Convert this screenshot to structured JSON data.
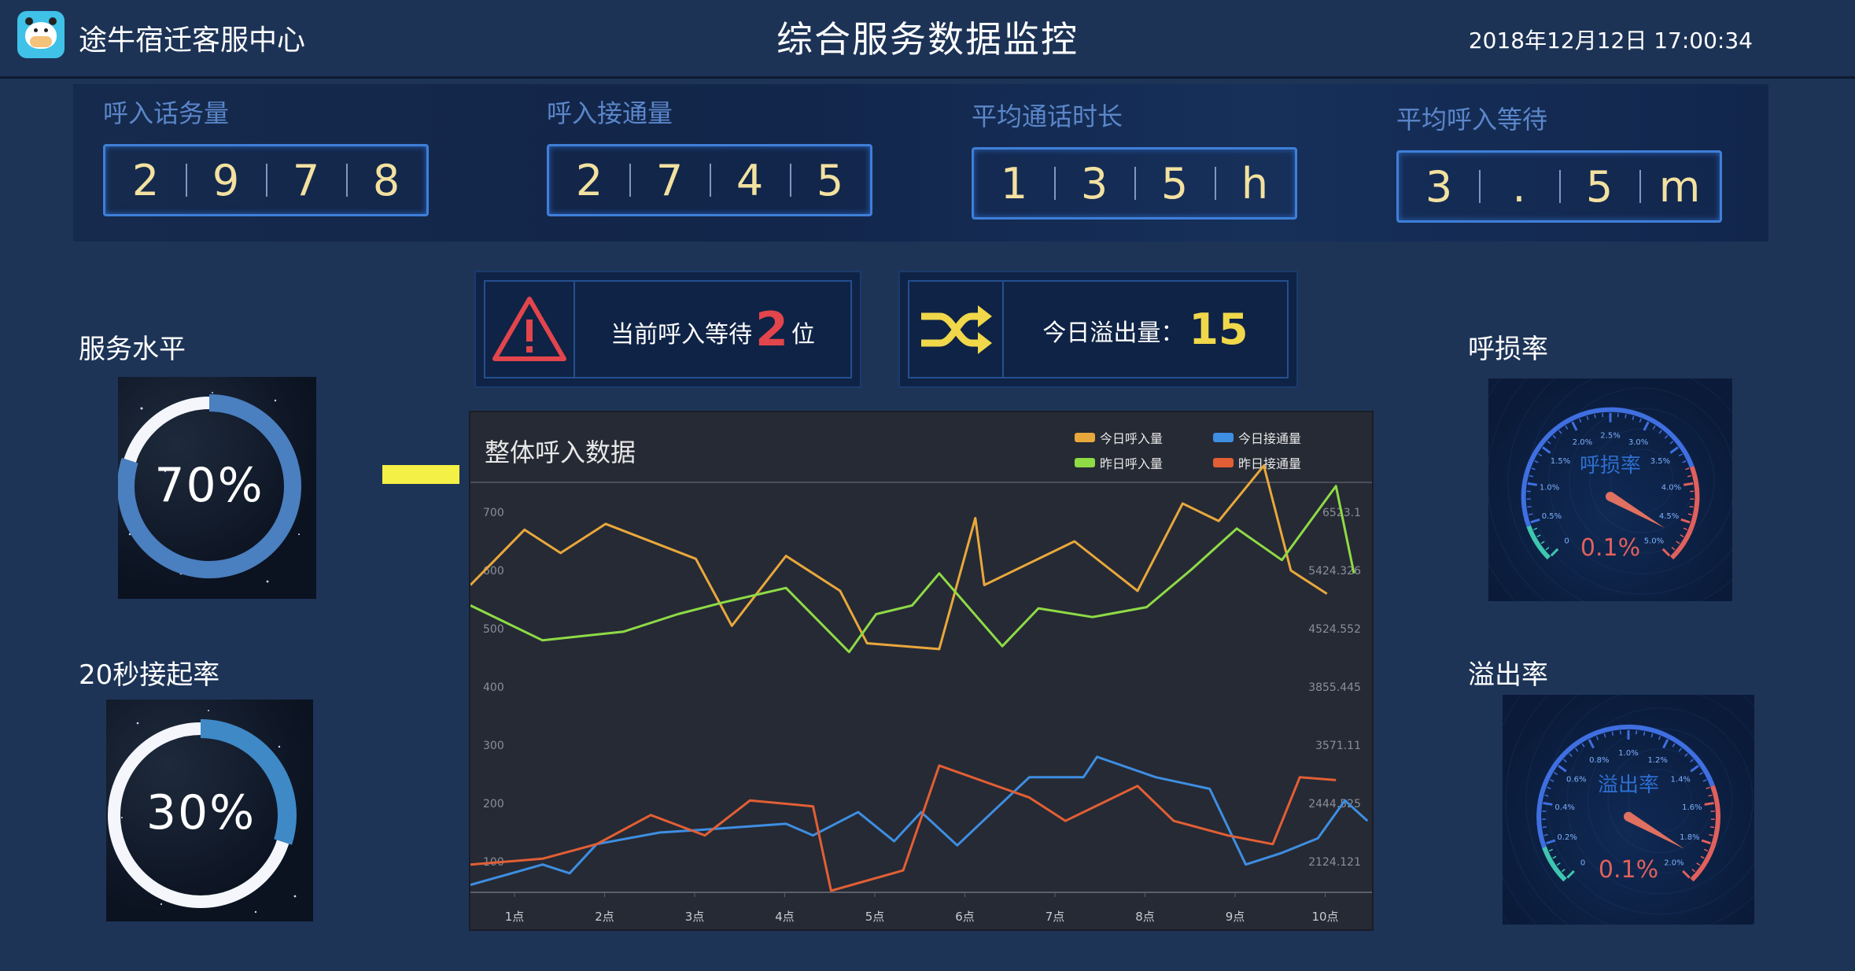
{
  "header": {
    "app_title": "途牛宿迁客服中心",
    "page_title": "综合服务数据监控",
    "datetime": "2018年12月12日 17:00:34"
  },
  "kpis": [
    {
      "label": "呼入话务量",
      "digits": [
        "2",
        "9",
        "7",
        "8"
      ]
    },
    {
      "label": "呼入接通量",
      "digits": [
        "2",
        "7",
        "4",
        "5"
      ]
    },
    {
      "label": "平均通话时长",
      "digits": [
        "1",
        "3",
        "5",
        "h"
      ]
    },
    {
      "label": "平均呼入等待",
      "digits": [
        "3",
        ".",
        "5",
        "m"
      ]
    }
  ],
  "alerts": {
    "waiting_prefix": "当前呼入等待",
    "waiting_count": "2",
    "waiting_suffix": "位",
    "overflow_label": "今日溢出量：",
    "overflow_count": "15"
  },
  "left_panels": {
    "service_level": {
      "label": "服务水平",
      "value_text": "70%",
      "value": 0.7
    },
    "answer_20s": {
      "label": "20秒接起率",
      "value_text": "30%",
      "value": 0.3
    }
  },
  "right_panels": {
    "loss_rate": {
      "label": "呼损率",
      "gauge_title": "呼损率",
      "value_text": "0.1%",
      "value": 0.1,
      "ticks": [
        "0",
        "0.5%",
        "1.0%",
        "1.5%",
        "2.0%",
        "2.5%",
        "3.0%",
        "3.5%",
        "4.0%",
        "4.5%",
        "5.0%"
      ]
    },
    "overflow_rate": {
      "label": "溢出率",
      "gauge_title": "溢出率",
      "value_text": "0.1%",
      "value": 0.1,
      "ticks": [
        "0",
        "0.2%",
        "0.4%",
        "0.6%",
        "0.8%",
        "1.0%",
        "1.2%",
        "1.4%",
        "1.6%",
        "1.8%",
        "2.0%"
      ]
    }
  },
  "colors": {
    "today_calls": "#e9a83c",
    "today_connected": "#3e8ee2",
    "yesterday_calls": "#8edb46",
    "yesterday_connected": "#e25f35"
  },
  "chart_data": {
    "type": "line",
    "title": "整体呼入数据",
    "x_labels": [
      "1点",
      "2点",
      "3点",
      "4点",
      "5点",
      "6点",
      "7点",
      "8点",
      "9点",
      "10点"
    ],
    "y_left_ticks": [
      "100",
      "200",
      "300",
      "400",
      "500",
      "600",
      "700"
    ],
    "y_right_ticks": [
      "2124.121",
      "2444.525",
      "3571.11",
      "3855.445",
      "4524.552",
      "5424.326",
      "6523.1"
    ],
    "ylim": [
      50,
      750
    ],
    "x": [
      0,
      0.2,
      0.4,
      0.6,
      0.8,
      1,
      1.2,
      1.4,
      1.6,
      1.8,
      2,
      2.2,
      2.4,
      2.6,
      2.8,
      3,
      3.2,
      3.4,
      3.6,
      3.8,
      4,
      4.2,
      4.4,
      4.6,
      4.8,
      5,
      5.2,
      5.4,
      5.6,
      5.8,
      6,
      6.2,
      6.4,
      6.6,
      6.8,
      7,
      7.2,
      7.4,
      7.6,
      7.8,
      8,
      8.2,
      8.4,
      8.6,
      8.8,
      9,
      9.2,
      9.4,
      9.6,
      9.8,
      10
    ],
    "series": [
      {
        "name": "今日呼入量",
        "color_key": "today_calls",
        "points": [
          [
            0,
            575
          ],
          [
            0.6,
            670
          ],
          [
            1,
            630
          ],
          [
            1.5,
            680
          ],
          [
            2.5,
            620
          ],
          [
            2.9,
            505
          ],
          [
            3.5,
            625
          ],
          [
            4.1,
            565
          ],
          [
            4.4,
            475
          ],
          [
            5.2,
            465
          ],
          [
            5.6,
            690
          ],
          [
            5.7,
            575
          ],
          [
            6.7,
            650
          ],
          [
            7.4,
            565
          ],
          [
            7.9,
            715
          ],
          [
            8.3,
            685
          ],
          [
            8.8,
            780
          ],
          [
            9.1,
            600
          ],
          [
            9.5,
            560
          ]
        ]
      },
      {
        "name": "昨日呼入量",
        "color_key": "yesterday_calls",
        "points": [
          [
            0,
            540
          ],
          [
            0.8,
            480
          ],
          [
            1.7,
            495
          ],
          [
            2.3,
            525
          ],
          [
            2.8,
            545
          ],
          [
            3.5,
            570
          ],
          [
            4.2,
            460
          ],
          [
            4.5,
            525
          ],
          [
            4.9,
            540
          ],
          [
            5.2,
            595
          ],
          [
            5.9,
            470
          ],
          [
            6.3,
            535
          ],
          [
            6.9,
            520
          ],
          [
            7.5,
            537
          ],
          [
            8.0,
            602
          ],
          [
            8.5,
            672
          ],
          [
            9.0,
            618
          ],
          [
            9.6,
            745
          ],
          [
            9.8,
            595
          ]
        ]
      },
      {
        "name": "今日接通量",
        "color_key": "today_connected",
        "points": [
          [
            0,
            60
          ],
          [
            0.8,
            95
          ],
          [
            1.1,
            80
          ],
          [
            1.4,
            130
          ],
          [
            2.1,
            150
          ],
          [
            2.6,
            155
          ],
          [
            3.5,
            165
          ],
          [
            3.8,
            145
          ],
          [
            4.3,
            185
          ],
          [
            4.7,
            135
          ],
          [
            5.0,
            185
          ],
          [
            5.4,
            128
          ],
          [
            6.2,
            245
          ],
          [
            6.8,
            245
          ],
          [
            6.95,
            280
          ],
          [
            7.6,
            245
          ],
          [
            8.2,
            225
          ],
          [
            8.6,
            95
          ],
          [
            9.0,
            115
          ],
          [
            9.4,
            140
          ],
          [
            9.7,
            205
          ],
          [
            9.95,
            170
          ]
        ]
      },
      {
        "name": "昨日接通量",
        "color_key": "yesterday_connected",
        "points": [
          [
            0,
            95
          ],
          [
            0.8,
            105
          ],
          [
            1.4,
            130
          ],
          [
            2.0,
            180
          ],
          [
            2.6,
            145
          ],
          [
            3.1,
            205
          ],
          [
            3.8,
            195
          ],
          [
            4.0,
            50
          ],
          [
            4.8,
            85
          ],
          [
            5.2,
            265
          ],
          [
            6.2,
            210
          ],
          [
            6.6,
            170
          ],
          [
            7.4,
            230
          ],
          [
            7.8,
            170
          ],
          [
            8.4,
            145
          ],
          [
            8.9,
            130
          ],
          [
            9.2,
            245
          ],
          [
            9.6,
            240
          ]
        ]
      }
    ]
  }
}
